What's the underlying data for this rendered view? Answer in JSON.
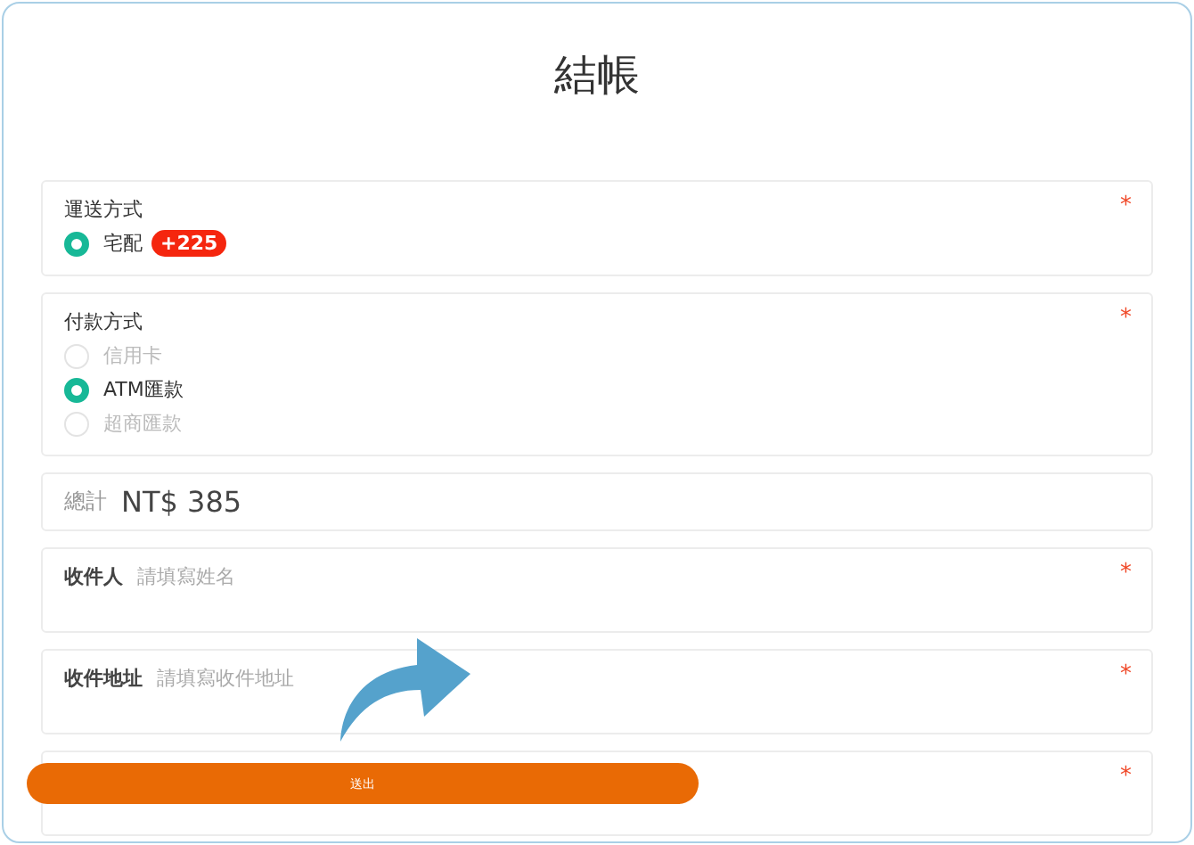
{
  "title": "結帳",
  "sections": [
    {
      "kind": "radio",
      "label": "運送方式",
      "required_mark": "*",
      "options": [
        {
          "label": "宅配",
          "selected": true,
          "disabled": false,
          "badge": "+225"
        }
      ]
    },
    {
      "kind": "radio",
      "label": "付款方式",
      "required_mark": "*",
      "options": [
        {
          "label": "信用卡",
          "selected": false,
          "disabled": true
        },
        {
          "label": "ATM匯款",
          "selected": true,
          "disabled": false
        },
        {
          "label": "超商匯款",
          "selected": false,
          "disabled": true
        }
      ]
    },
    {
      "kind": "total",
      "label": "總計",
      "value": "NT$ 385"
    },
    {
      "kind": "field",
      "label": "收件人",
      "placeholder": "請填寫姓名",
      "required_mark": "*"
    },
    {
      "kind": "field",
      "label": "收件地址",
      "placeholder": "請填寫收件地址",
      "required_mark": "*"
    },
    {
      "kind": "blank",
      "required_mark": "*"
    }
  ],
  "submit_button": "送出"
}
